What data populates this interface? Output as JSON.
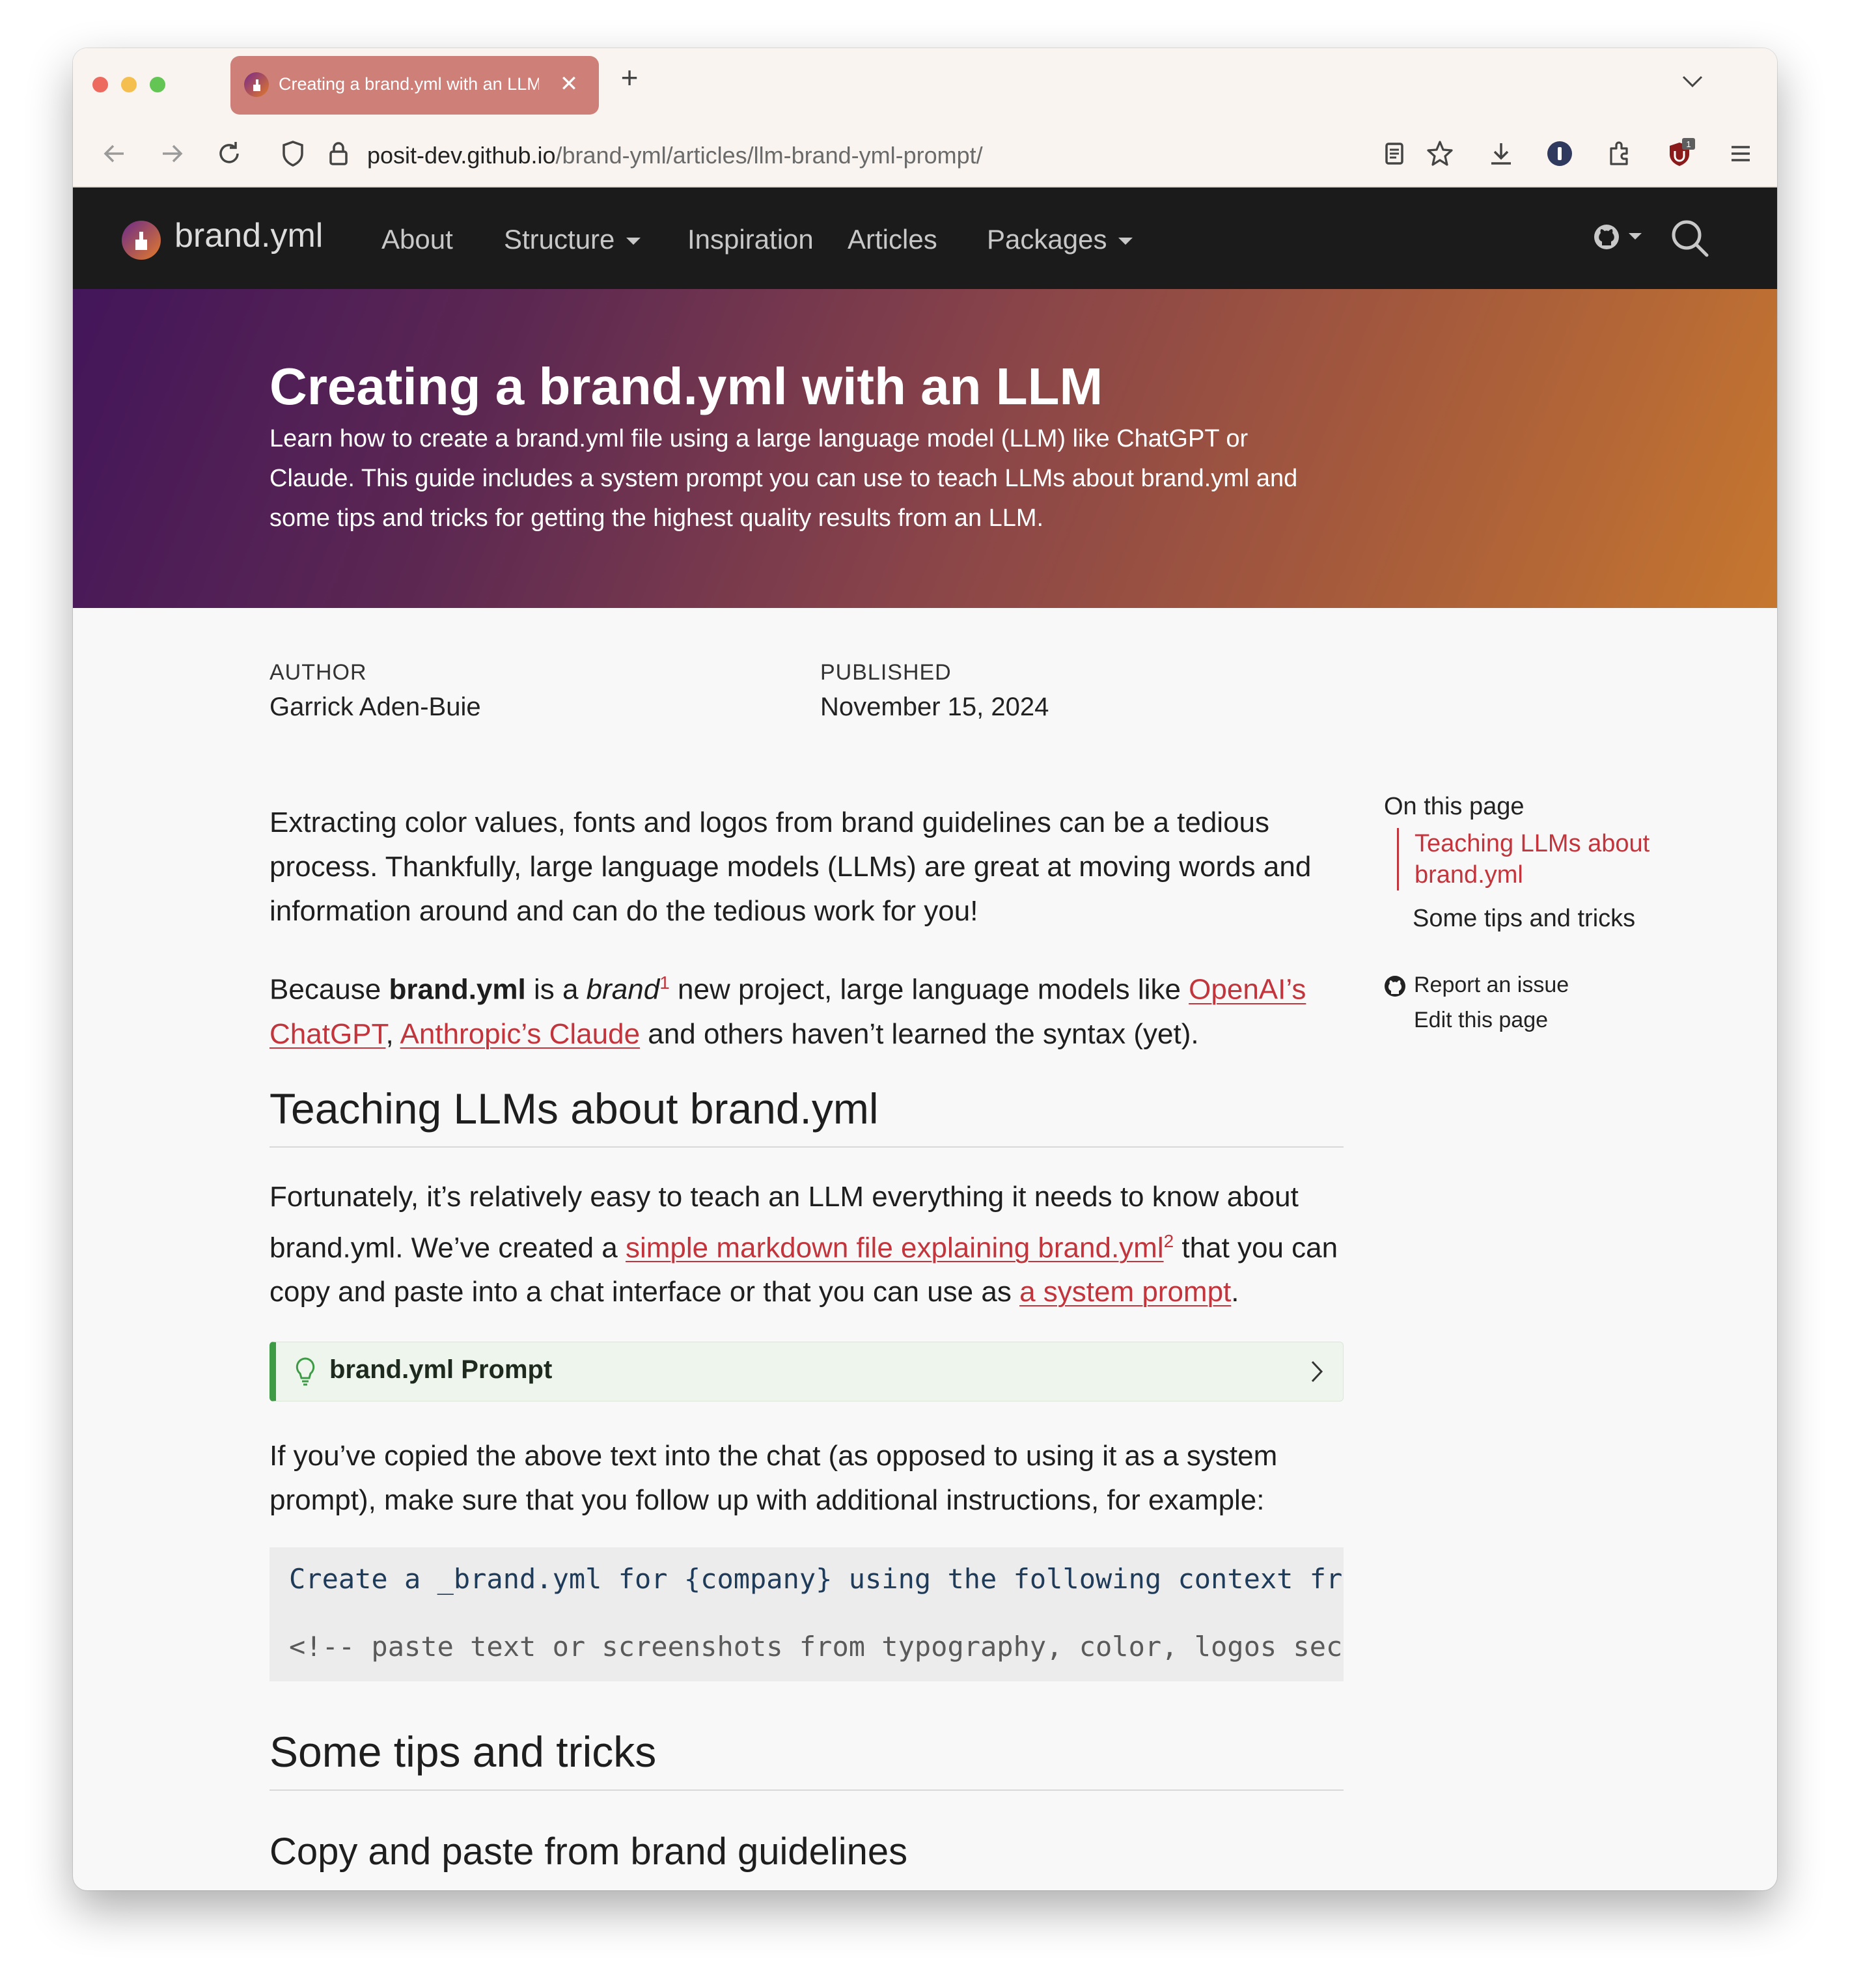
{
  "browser": {
    "tab_title": "Creating a brand.yml with an LLM",
    "new_tab": "+",
    "close_tab": "✕",
    "url_domain": "posit-dev.github.io",
    "url_path": "/brand-yml/articles/llm-brand-yml-prompt/",
    "extension_badge": "1",
    "icons": [
      "back-icon",
      "forward-icon",
      "reload-icon",
      "shield-icon",
      "lock-icon",
      "reader-view-icon",
      "star-icon",
      "download-icon",
      "password-manager-icon",
      "extensions-icon",
      "ublock-icon",
      "menu-icon"
    ]
  },
  "site_nav": {
    "brand": "brand.yml",
    "items": [
      "About",
      "Structure",
      "Inspiration",
      "Articles",
      "Packages"
    ]
  },
  "hero": {
    "title": "Creating a brand.yml with an LLM",
    "subtitle": "Learn how to create a brand.yml file using a large language model (LLM) like ChatGPT or Claude. This guide includes a system prompt you can use to teach LLMs about brand.yml and some tips and tricks for getting the highest quality results from an LLM.",
    "gradient": [
      "#43155a",
      "#86424a",
      "#c6772f"
    ]
  },
  "meta": {
    "author_label": "AUTHOR",
    "author": "Garrick Aden-Buie",
    "published_label": "PUBLISHED",
    "published": "November 15, 2024"
  },
  "article": {
    "intro": "Extracting color values, fonts and logos from brand guidelines can be a tedious process. Thankfully, large language models (LLMs) are great at moving words and information around and can do the tedious work for you!",
    "p2": {
      "because": "Because ",
      "brand_bold": "brand.yml",
      "is_a": " is a ",
      "brand_italic": "brand",
      "fn1": "1",
      "after": " new project, large language models like ",
      "link_chatgpt": "OpenAI’s ChatGPT",
      "comma": ", ",
      "link_claude": "Anthropic’s Claude",
      "tail": " and others haven’t learned the syntax (yet)."
    },
    "h2_teaching": "Teaching LLMs about brand.yml",
    "p3": {
      "start": "Fortunately, it’s relatively easy to teach an LLM everything it needs to know about brand.yml. We’ve created a ",
      "link_md": "simple markdown file explaining brand.yml",
      "fn2": "2",
      "mid": " that you can copy and paste into a chat interface or that you can use as ",
      "link_sys": "a system prompt",
      "end": "."
    },
    "callout_title": "brand.yml Prompt",
    "p4": "If you’ve copied the above text into the chat (as opposed to using it as a system prompt), make sure that you follow up with additional instructions, for example:",
    "code_line1": "Create a _brand.yml for {company} using the following context from",
    "code_line2": "<!-- paste text or screenshots from typography, color, logos sections -->",
    "h2_tips": "Some tips and tricks",
    "h3_copy": "Copy and paste from brand guidelines"
  },
  "toc": {
    "title": "On this page",
    "items": [
      "Teaching LLMs about brand.yml",
      "Some tips and tricks"
    ],
    "report_issue": "Report an issue",
    "edit_page": "Edit this page"
  },
  "colors": {
    "link": "#c2353c",
    "navbar_bg": "#1b1b1b",
    "callout_accent": "#3d9b45",
    "tab_bg": "#cd7f78"
  }
}
